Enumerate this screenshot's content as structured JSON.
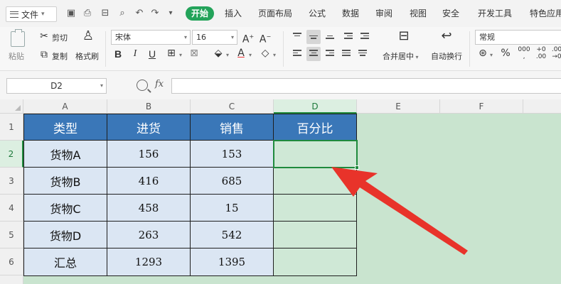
{
  "menubar": {
    "file_label": "文件",
    "tabs": [
      "开始",
      "插入",
      "页面布局",
      "公式",
      "数据",
      "审阅",
      "视图",
      "安全",
      "开发工具",
      "特色应用"
    ],
    "active_tab": "开始",
    "accent_color": "#23a35a"
  },
  "ribbon": {
    "paste_label": "粘贴",
    "cut_label": "剪切",
    "copy_label": "复制",
    "format_painter_label": "格式刷",
    "font_name": "宋体",
    "font_size": "16",
    "bold": "B",
    "italic": "I",
    "underline": "U",
    "merge_center_label": "合并居中",
    "wrap_text_label": "自动换行",
    "number_format": "常规",
    "percent_symbol": "%"
  },
  "formula_bar": {
    "name_box": "D2",
    "fx_label": "fx",
    "formula": ""
  },
  "sheet": {
    "columns": [
      "A",
      "B",
      "C",
      "D",
      "E",
      "F"
    ],
    "rows": [
      "1",
      "2",
      "3",
      "4",
      "5",
      "6"
    ],
    "header_row": [
      "类型",
      "进货",
      "销售",
      "百分比"
    ],
    "data_rows": [
      [
        "货物A",
        "156",
        "153",
        ""
      ],
      [
        "货物B",
        "416",
        "685",
        ""
      ],
      [
        "货物C",
        "458",
        "15",
        ""
      ],
      [
        "货物D",
        "263",
        "542",
        ""
      ],
      [
        "汇总",
        "1293",
        "1395",
        ""
      ]
    ],
    "active_cell": "D2",
    "colors": {
      "header_fill": "#3a77b8",
      "cell_fill": "#dbe6f3",
      "sheet_background": "#c9e4cf",
      "selection": "#1f8a3d",
      "annotation_arrow": "#e8332a"
    }
  }
}
